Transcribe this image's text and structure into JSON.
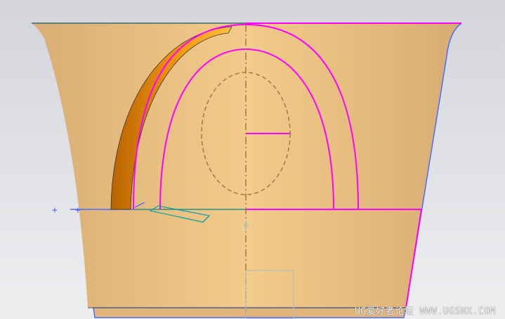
{
  "watermark": "UG爱好者论坛 WWW.UGSNX.COM",
  "colors": {
    "body": "#e9c285",
    "curve": "#ff00ff",
    "edge": "#4a6cff",
    "sweep": "#e08a00",
    "dashed": "#a07a40"
  }
}
